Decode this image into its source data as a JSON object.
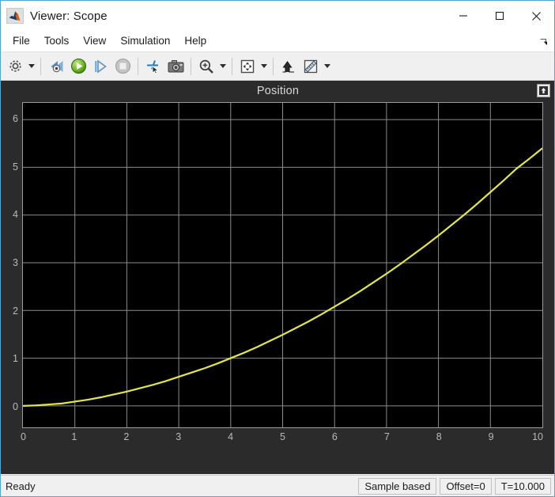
{
  "window": {
    "title": "Viewer: Scope",
    "app_icon": "matlab-membrane-icon",
    "minimize_label": "—",
    "maximize_label": "□",
    "close_label": "✕"
  },
  "menu": {
    "items": [
      {
        "label": "File"
      },
      {
        "label": "Tools"
      },
      {
        "label": "View"
      },
      {
        "label": "Simulation"
      },
      {
        "label": "Help"
      }
    ],
    "undock_icon": "undock-arrow-icon"
  },
  "toolbar": {
    "groups": [
      {
        "buttons": [
          {
            "name": "configuration-properties-button",
            "icon": "gear-icon",
            "caret": true
          }
        ]
      },
      {
        "buttons": [
          {
            "name": "step-back-button",
            "icon": "step-back-icon",
            "caret": false
          },
          {
            "name": "run-button",
            "icon": "play-icon",
            "caret": false
          },
          {
            "name": "step-forward-button",
            "icon": "step-forward-icon",
            "caret": false
          },
          {
            "name": "stop-button",
            "icon": "stop-icon",
            "caret": false
          }
        ]
      },
      {
        "buttons": [
          {
            "name": "highlight-signal-button",
            "icon": "signal-selector-icon",
            "caret": false
          },
          {
            "name": "snapshot-button",
            "icon": "camera-icon",
            "caret": false
          }
        ]
      },
      {
        "buttons": [
          {
            "name": "zoom-in-button",
            "icon": "zoom-in-icon",
            "caret": true
          }
        ]
      },
      {
        "buttons": [
          {
            "name": "autoscale-button",
            "icon": "fit-to-view-icon",
            "caret": true
          }
        ]
      },
      {
        "buttons": [
          {
            "name": "signal-trace-button",
            "icon": "trace-arrow-icon",
            "caret": false
          },
          {
            "name": "measurements-button",
            "icon": "ruler-icon",
            "caret": true
          }
        ]
      }
    ]
  },
  "plot": {
    "title": "Position",
    "panel_button_icon": "maximize-panel-icon"
  },
  "status": {
    "ready": "Ready",
    "cells": [
      {
        "label": "Sample based"
      },
      {
        "label": "Offset=0"
      },
      {
        "label": "T=10.000"
      }
    ]
  },
  "chart_data": {
    "type": "line",
    "title": "Position",
    "xlabel": "",
    "ylabel": "",
    "xlim": [
      0,
      10
    ],
    "ylim": [
      -0.45,
      6.35
    ],
    "xticks": [
      0,
      1,
      2,
      3,
      4,
      5,
      6,
      7,
      8,
      9,
      10
    ],
    "yticks": [
      0,
      1,
      2,
      3,
      4,
      5,
      6
    ],
    "grid": true,
    "grid_color": "#8c8c8c",
    "background": "#000000",
    "legend": "none",
    "series": [
      {
        "name": "Position",
        "color": "#e5e54a",
        "line_width": 1.6,
        "x": [
          0,
          0.25,
          0.5,
          0.75,
          1,
          1.25,
          1.5,
          1.75,
          2,
          2.25,
          2.5,
          2.75,
          3,
          3.25,
          3.5,
          3.75,
          4,
          4.25,
          4.5,
          4.75,
          5,
          5.25,
          5.5,
          5.75,
          6,
          6.25,
          6.5,
          6.75,
          7,
          7.25,
          7.5,
          7.75,
          8,
          8.25,
          8.5,
          8.75,
          9,
          9.25,
          9.5,
          9.75,
          10
        ],
        "y": [
          0.0,
          0.01,
          0.03,
          0.05,
          0.09,
          0.13,
          0.18,
          0.24,
          0.3,
          0.37,
          0.44,
          0.52,
          0.61,
          0.7,
          0.79,
          0.89,
          1.0,
          1.11,
          1.23,
          1.36,
          1.49,
          1.63,
          1.77,
          1.92,
          2.08,
          2.24,
          2.41,
          2.59,
          2.77,
          2.96,
          3.16,
          3.36,
          3.57,
          3.79,
          4.01,
          4.24,
          4.48,
          4.72,
          4.97,
          5.18,
          5.4
        ]
      }
    ]
  }
}
